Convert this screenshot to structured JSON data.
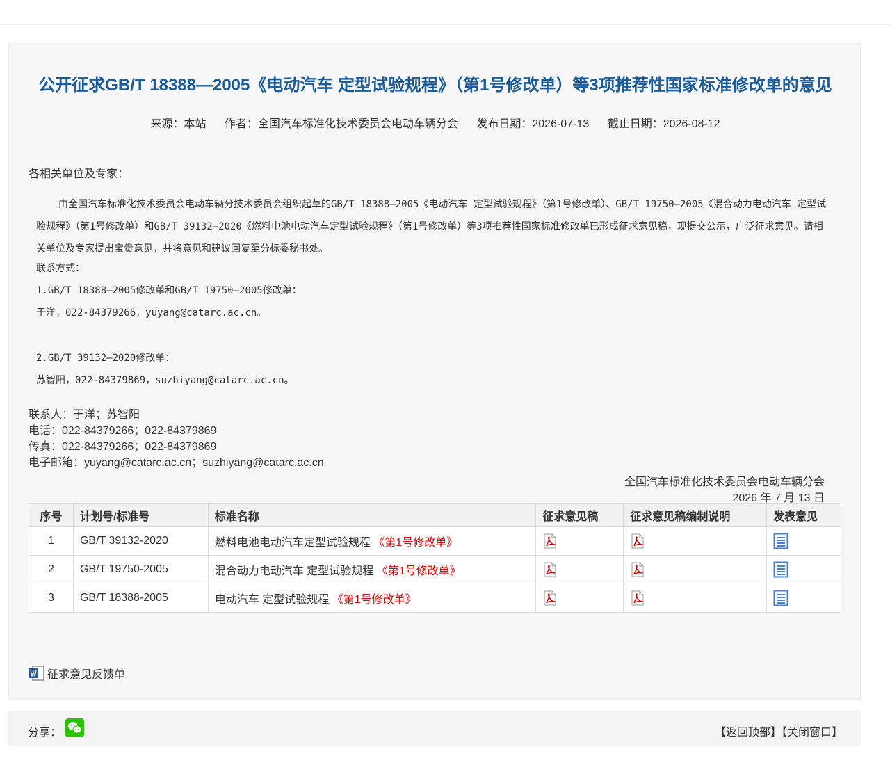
{
  "article": {
    "title": "公开征求GB/T 18388—2005《电动汽车 定型试验规程》（第1号修改单）等3项推荐性国家标准修改单的意见",
    "meta": {
      "source": "来源：本站",
      "author": "作者：全国汽车标准化技术委员会电动车辆分会",
      "publish_date": "发布日期：2026-07-13",
      "deadline": "截止日期：2026-08-12"
    },
    "salutation": "各相关单位及专家：",
    "body": "由全国汽车标准化技术委员会电动车辆分技术委员会组织起草的GB/T 18388—2005《电动汽车 定型试验规程》（第1号修改单）、GB/T 19750—2005《混合动力电动汽车 定型试验规程》（第1号修改单）和GB/T 39132—2020《燃料电池电动汽车定型试验规程》（第1号修改单）等3项推荐性国家标准修改单已形成征求意见稿，现提交公示，广泛征求意见。请相关单位及专家提出宝贵意见，并将意见和建议回复至分标委秘书处。",
    "contact_heading": "联系方式：",
    "contact_1_title": "1.GB/T 18388—2005修改单和GB/T 19750—2005修改单：",
    "contact_1_detail": "于洋，022-84379266，yuyang@catarc.ac.cn。",
    "contact_2_title": "2.GB/T 39132—2020修改单：",
    "contact_2_detail": "苏智阳，022-84379869，suzhiyang@catarc.ac.cn。",
    "contact_person": "联系人：于洋；苏智阳",
    "phone": "电话：022-84379266；022-84379869",
    "fax": "传真：022-84379266；022-84379869",
    "email": "电子邮箱：yuyang@catarc.ac.cn；suzhiyang@catarc.ac.cn",
    "signature_org": "全国汽车标准化技术委员会电动车辆分会",
    "signature_date": "2026 年 7 月 13 日"
  },
  "table": {
    "headers": [
      "序号",
      "计划号/标准号",
      "标准名称",
      "征求意见稿",
      "征求意见稿编制说明",
      "发表意见"
    ],
    "rows": [
      {
        "no": "1",
        "code": "GB/T 39132-2020",
        "name": "燃料电池电动汽车定型试验规程",
        "tag": "《第1号修改单》"
      },
      {
        "no": "2",
        "code": "GB/T 19750-2005",
        "name": "混合动力电动汽车 定型试验规程",
        "tag": "《第1号修改单》"
      },
      {
        "no": "3",
        "code": "GB/T 18388-2005",
        "name": "电动汽车 定型试验规程",
        "tag": "《第1号修改单》"
      }
    ]
  },
  "feedback_label": "征求意见反馈单",
  "share": {
    "label": "分享：",
    "back_top": "【返回顶部】",
    "close_window": "【关闭窗口】"
  },
  "colors": {
    "title": "#1a5c99",
    "highlight": "#e00000",
    "wechat": "#2dc100",
    "doc_icon": "#4a7fd4"
  }
}
